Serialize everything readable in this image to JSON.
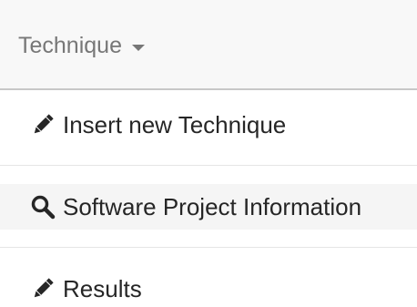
{
  "navbar": {
    "dropdown_label": "Technique"
  },
  "menu": {
    "items": [
      {
        "label": "Insert new Technique",
        "icon": "pencil-icon"
      },
      {
        "label": "Software Project Information",
        "icon": "search-icon"
      },
      {
        "label": "Results",
        "icon": "pencil-icon"
      }
    ]
  }
}
